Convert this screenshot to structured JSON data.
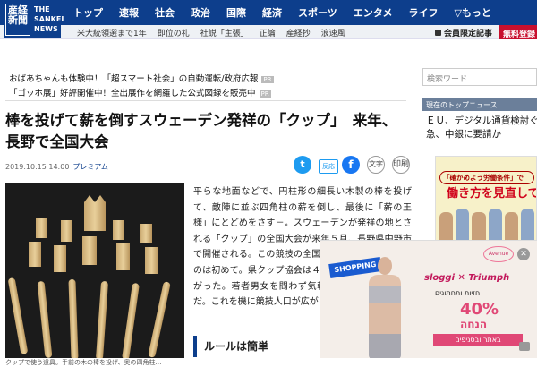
{
  "header": {
    "logo_kanji": "産経新聞",
    "logo_en": [
      "THE",
      "SANKEI",
      "NEWS"
    ],
    "nav": [
      "トップ",
      "速報",
      "社会",
      "政治",
      "国際",
      "経済",
      "スポーツ",
      "エンタメ",
      "ライフ",
      "▽もっと"
    ],
    "tags": [
      "米大統領選まで1年",
      "即位の礼",
      "社説「主張」",
      "正論",
      "産経抄",
      "浪速風"
    ],
    "member_link": "会員限定記事",
    "free_label": "無料登録"
  },
  "promos": [
    {
      "text": "おばあちゃんも体験中！「超スマート社会」の自動運転/政府広報",
      "badge": "PR"
    },
    {
      "text": "「ゴッホ展」好評開催中！全出展作を網羅した公式図録を販売中",
      "badge": "PR"
    }
  ],
  "article": {
    "headline": "棒を投げて薪を倒すスウェーデン発祥の「クップ」　来年、長野で全国大会",
    "date": "2019.10.15 14:00",
    "premium": "プレミアム",
    "share": {
      "twitter": "t",
      "hanron": "反応",
      "facebook": "f",
      "font": "文字",
      "print": "印刷"
    },
    "body": "平らな地面などで、円柱形の細長い木製の棒を投げて、敵陣に並ぶ四角柱の薪を倒し、最後に「薪の王様」にとどめをさす－。スウェーデンが発祥の地とされる「クップ」の全国大会が来年５月、長野県中野市で開催される。この競技の全国大会が県内で開かれるのは初めて。県クップ協会は４月に中野支部が立ち上がった。若者男女を問わず気軽さが受けているようだ。これを機に競技人口が広がる気配もうかがえる。",
    "section_heading": "ルールは簡単",
    "caption": "クップで使う道具。手前の木の棒を投げ、奥の四角柱…"
  },
  "sidebar": {
    "search_placeholder": "検索ワード",
    "topnews_label": "現在のトップニュース",
    "topnews_text": "ＥＵ、デジタル通貨検討ぐ急、中銀に要請か",
    "ad_tagline": "「確かめよう労働条件」で",
    "ad_headline": "働き方を見直して"
  },
  "bottom_ad": {
    "shopping": "SHOPPING",
    "circle": "Avenue",
    "brands": "sloggi ✕ Triumph",
    "hebrew1": "חזיות ותחתונים",
    "pct": "40%",
    "hebrew2": "הנחה",
    "hebrew3": "באתר ובסניפים"
  }
}
